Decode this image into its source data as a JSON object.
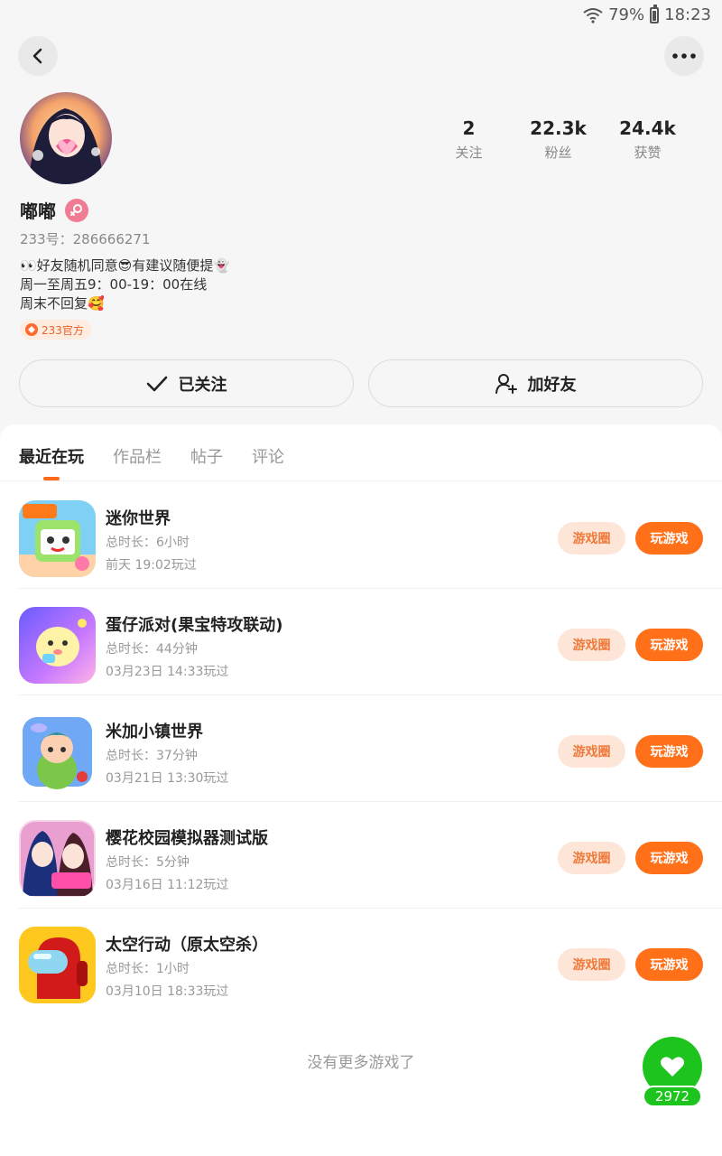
{
  "status_bar": {
    "battery_percent": "79%",
    "time": "18:23",
    "wifi_icon": "wifi-icon",
    "battery_icon": "battery-icon"
  },
  "header": {
    "back_icon": "chevron-left-icon",
    "more_icon": "more-dots-icon"
  },
  "profile": {
    "name": "嘟嘟",
    "gender_icon": "female-icon",
    "uid": "233号：286666271",
    "bio_lines": [
      "👀好友随机同意😎有建议随便提👻",
      "周一至周五9：00-19：00在线",
      "周末不回复🥰"
    ],
    "official_badge": "233官方",
    "stats": [
      {
        "value": "2",
        "label": "关注"
      },
      {
        "value": "22.3k",
        "label": "粉丝"
      },
      {
        "value": "24.4k",
        "label": "获赞"
      }
    ],
    "follow_label": "已关注",
    "add_friend_label": "加好友"
  },
  "tabs": [
    {
      "label": "最近在玩",
      "active": true
    },
    {
      "label": "作品栏",
      "active": false
    },
    {
      "label": "帖子",
      "active": false
    },
    {
      "label": "评论",
      "active": false
    }
  ],
  "games": [
    {
      "name": "迷你世界",
      "duration": "总时长：6小时",
      "last_played": "前天 19:02玩过",
      "circle_label": "游戏圈",
      "play_label": "玩游戏"
    },
    {
      "name": "蛋仔派对(果宝特攻联动)",
      "duration": "总时长：44分钟",
      "last_played": "03月23日 14:33玩过",
      "circle_label": "游戏圈",
      "play_label": "玩游戏"
    },
    {
      "name": "米加小镇世界",
      "duration": "总时长：37分钟",
      "last_played": "03月21日 13:30玩过",
      "circle_label": "游戏圈",
      "play_label": "玩游戏"
    },
    {
      "name": "樱花校园模拟器测试版",
      "duration": "总时长：5分钟",
      "last_played": "03月16日 11:12玩过",
      "circle_label": "游戏圈",
      "play_label": "玩游戏"
    },
    {
      "name": "太空行动（原太空杀）",
      "duration": "总时长：1小时",
      "last_played": "03月10日 18:33玩过",
      "circle_label": "游戏圈",
      "play_label": "玩游戏"
    }
  ],
  "footer_text": "没有更多游戏了",
  "like": {
    "count": "2972",
    "icon": "heart-icon"
  },
  "colors": {
    "accent": "#ff7019",
    "accent_light": "#fde6d7",
    "like_green": "#1ec41e"
  }
}
